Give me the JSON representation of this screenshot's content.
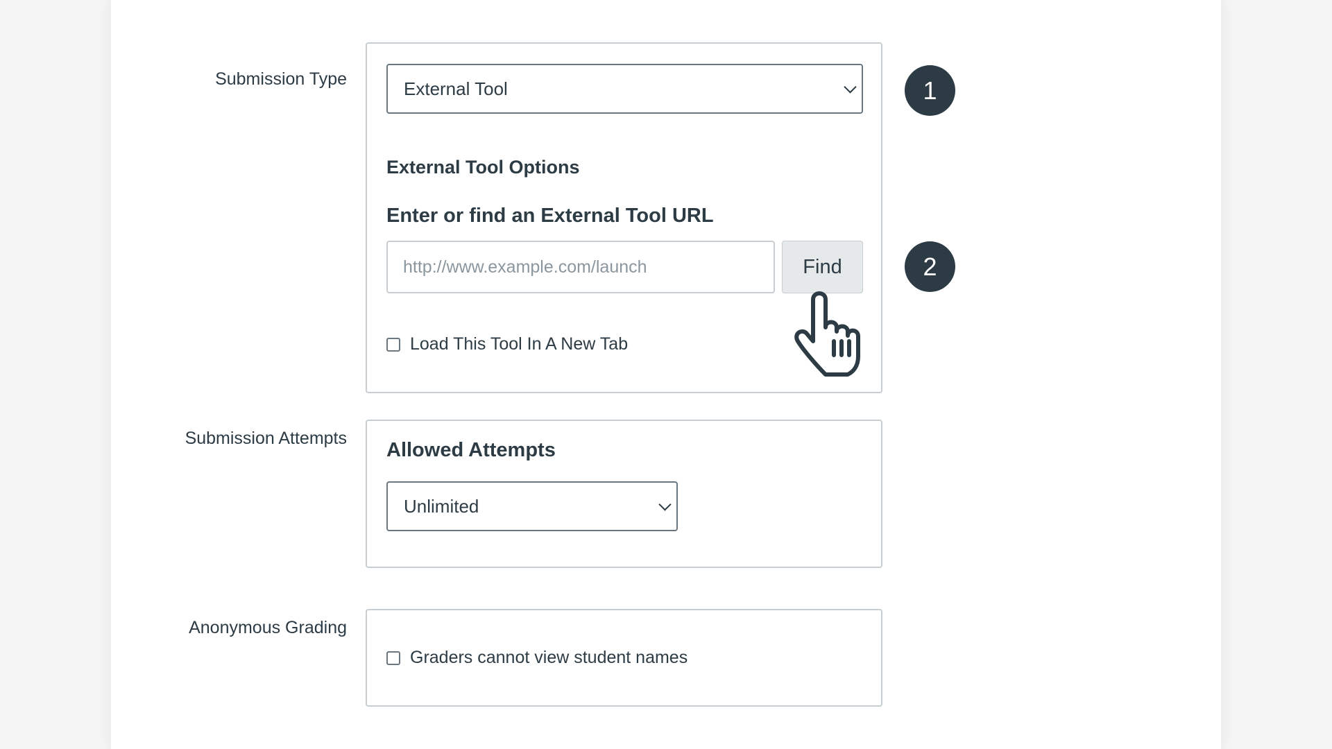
{
  "submission_type": {
    "label": "Submission Type",
    "selected": "External Tool",
    "options_heading": "External Tool Options",
    "url_heading": "Enter or find an External Tool URL",
    "url_placeholder": "http://www.example.com/launch",
    "url_value": "",
    "find_label": "Find",
    "new_tab_label": "Load This Tool In A New Tab",
    "new_tab_checked": false
  },
  "submission_attempts": {
    "label": "Submission Attempts",
    "heading": "Allowed Attempts",
    "selected": "Unlimited"
  },
  "anonymous_grading": {
    "label": "Anonymous Grading",
    "checkbox_label": "Graders cannot view student names",
    "checked": false
  },
  "callouts": {
    "one": "1",
    "two": "2"
  },
  "colors": {
    "text": "#2d3b45",
    "badge": "#2d3b45",
    "panel_border": "#c7cdd1",
    "button_bg": "#e6e9ea"
  }
}
